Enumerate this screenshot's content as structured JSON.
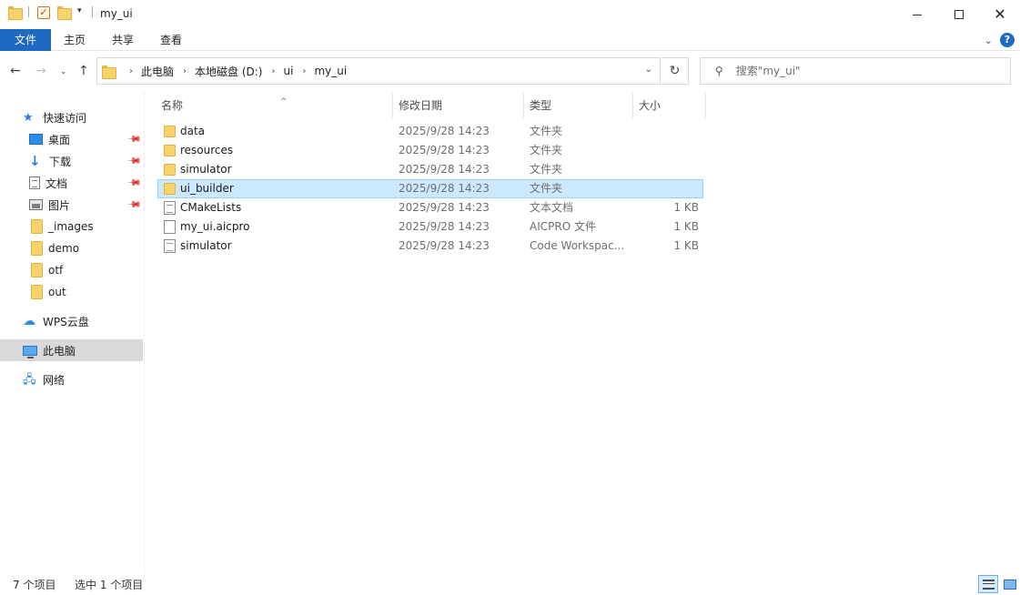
{
  "window": {
    "title": "my_ui"
  },
  "ribbon": {
    "tabs": [
      "文件",
      "主页",
      "共享",
      "查看"
    ]
  },
  "address": {
    "crumbs": [
      "此电脑",
      "本地磁盘 (D:)",
      "ui",
      "my_ui"
    ]
  },
  "search": {
    "placeholder": "搜索\"my_ui\""
  },
  "sidebar": {
    "quick_access": "快速访问",
    "items": [
      {
        "label": "桌面",
        "icon": "desktop-icon",
        "pinned": true
      },
      {
        "label": "下载",
        "icon": "download-icon",
        "pinned": true
      },
      {
        "label": "文档",
        "icon": "document-icon",
        "pinned": true
      },
      {
        "label": "图片",
        "icon": "picture-icon",
        "pinned": true
      },
      {
        "label": "_images",
        "icon": "folder-icon",
        "pinned": false
      },
      {
        "label": "demo",
        "icon": "folder-icon",
        "pinned": false
      },
      {
        "label": "otf",
        "icon": "folder-icon",
        "pinned": false
      },
      {
        "label": "out",
        "icon": "folder-icon",
        "pinned": false
      }
    ],
    "wps": "WPS云盘",
    "this_pc": "此电脑",
    "network": "网络"
  },
  "columns": {
    "name": "名称",
    "date": "修改日期",
    "type": "类型",
    "size": "大小"
  },
  "files": [
    {
      "name": "data",
      "date": "2025/9/28 14:23",
      "type": "文件夹",
      "size": "",
      "icon": "folder-icon"
    },
    {
      "name": "resources",
      "date": "2025/9/28 14:23",
      "type": "文件夹",
      "size": "",
      "icon": "folder-icon"
    },
    {
      "name": "simulator",
      "date": "2025/9/28 14:23",
      "type": "文件夹",
      "size": "",
      "icon": "folder-icon"
    },
    {
      "name": "ui_builder",
      "date": "2025/9/28 14:23",
      "type": "文件夹",
      "size": "",
      "icon": "folder-icon",
      "selected": true
    },
    {
      "name": "CMakeLists",
      "date": "2025/9/28 14:23",
      "type": "文本文档",
      "size": "1 KB",
      "icon": "text-file-icon"
    },
    {
      "name": "my_ui.aicpro",
      "date": "2025/9/28 14:23",
      "type": "AICPRO 文件",
      "size": "1 KB",
      "icon": "file-icon"
    },
    {
      "name": "simulator",
      "date": "2025/9/28 14:23",
      "type": "Code Workspac...",
      "size": "1 KB",
      "icon": "text-file-icon"
    }
  ],
  "status": {
    "count": "7 个项目",
    "selection": "选中 1 个项目"
  },
  "colors": {
    "accent": "#1e6ac3",
    "selected_row_bg": "#cce8ff",
    "selected_row_border": "#99d1ff",
    "folder": "#f8d36b",
    "sidebar_selected": "#d9d9d9"
  }
}
